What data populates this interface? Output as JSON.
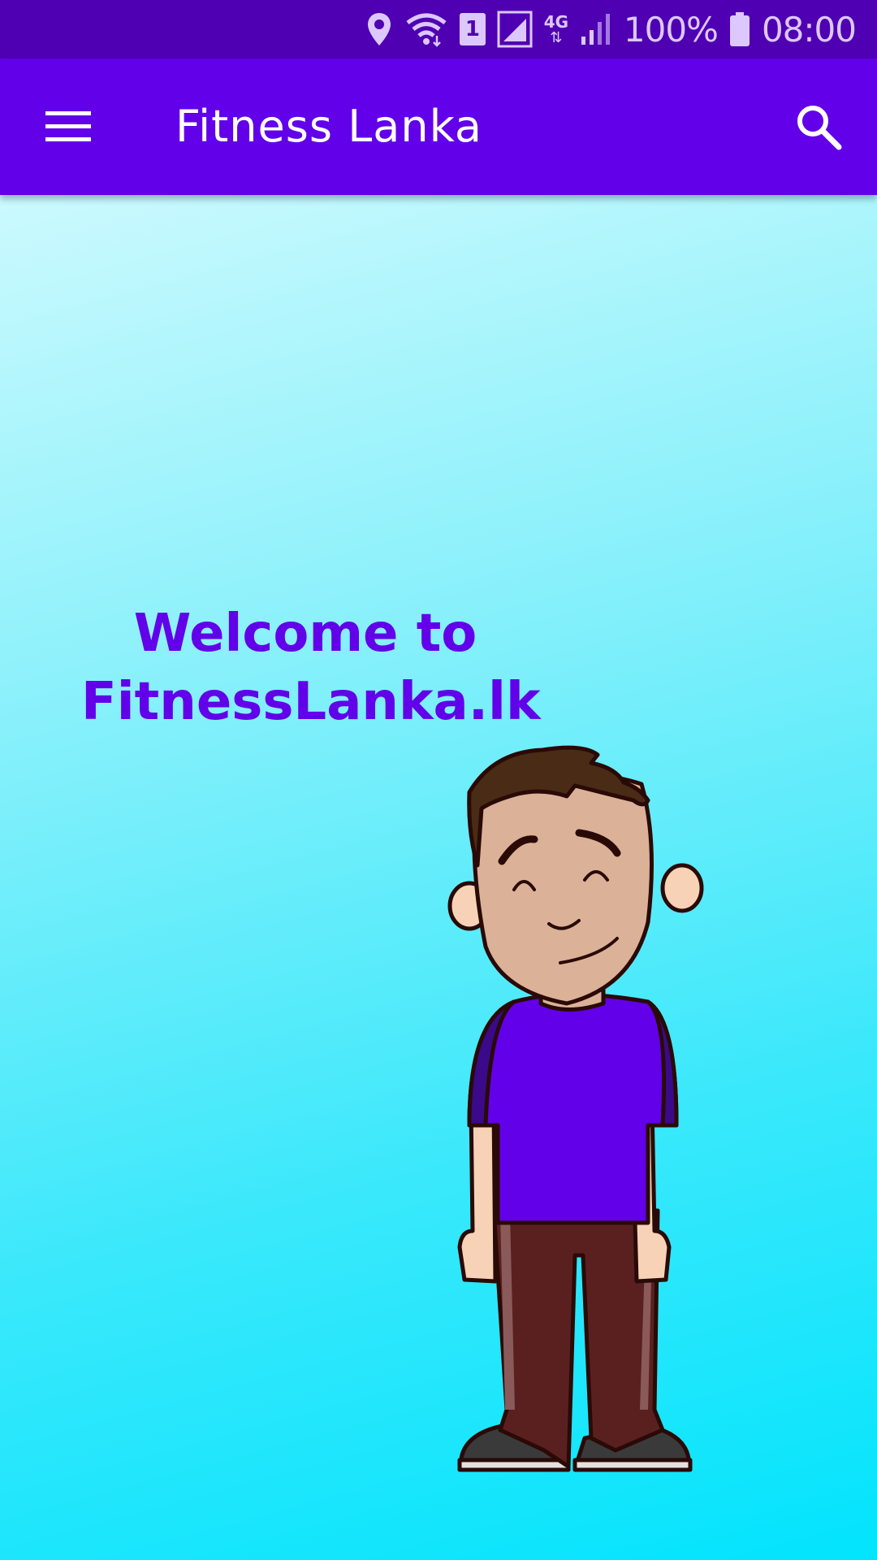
{
  "status_bar": {
    "battery_percent": "100%",
    "time": "08:00",
    "sim_label": "1",
    "network_type": "4G",
    "icons": [
      "location-icon",
      "wifi-icon",
      "sim-icon",
      "signal-icon",
      "network-4g-icon",
      "signal-icon",
      "battery-icon"
    ]
  },
  "app_bar": {
    "title": "Fitness Lanka",
    "menu_icon": "hamburger-menu-icon",
    "search_icon": "search-icon"
  },
  "main": {
    "welcome_line1": "Welcome to",
    "welcome_line2": "FitnessLanka.lk",
    "illustration": "cartoon-man-illustration"
  },
  "colors": {
    "status_bar": "#4f00b2",
    "app_bar": "#6200ea",
    "accent_text": "#6200ea",
    "background_top": "#e4fdff",
    "background_bottom": "#02e4fd"
  }
}
